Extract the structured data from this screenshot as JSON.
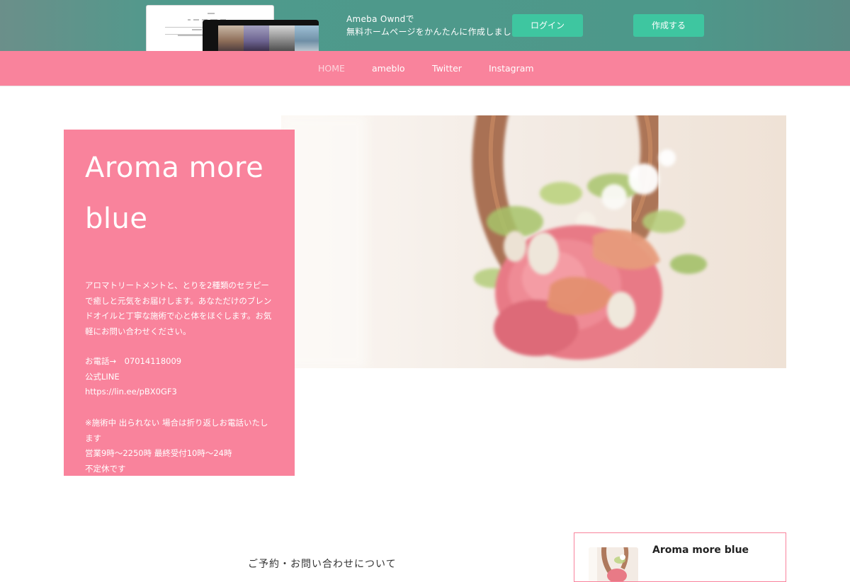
{
  "promo": {
    "line1": "Ameba Owndで",
    "line2": "無料ホームページをかんたんに作成しましょう！",
    "login_label": "ログイン",
    "create_label": "作成する",
    "button_color": "#3ec6a0"
  },
  "nav": {
    "items": [
      {
        "label": "HOME"
      },
      {
        "label": "ameblo"
      },
      {
        "label": "Twitter"
      },
      {
        "label": "Instagram"
      }
    ],
    "bar_color": "#f9839c"
  },
  "hero": {
    "title": "Aroma more blue",
    "description": "アロマトリートメントと、とりを2種類のセラピーで癒しと元気をお届けします。あなただけのブレンドオイルと丁寧な施術で心と体をほぐします。お気軽にお問い合わせください。",
    "contact": "お電話→　07014118009　　\n公式LINE\nhttps://lin.ee/pBX0GF3 　　\n\n※施術中 出られない 場合は折り返しお電話いたします\n営業9時～2250時 最終受付10時～24時\n不定休です",
    "panel_color": "#f9839c"
  },
  "main": {
    "heading": "ご予約・お問い合わせについて"
  },
  "profile": {
    "name": "Aroma more blue"
  }
}
